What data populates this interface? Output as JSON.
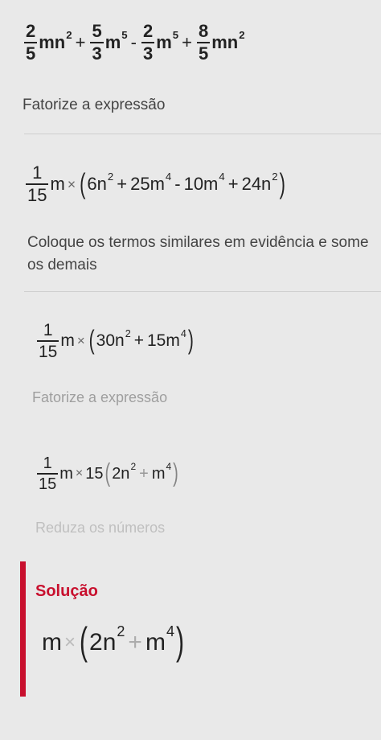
{
  "expression": {
    "f1": {
      "num": "2",
      "den": "5"
    },
    "t1": "mn",
    "e1": "2",
    "op1": "+",
    "f2": {
      "num": "5",
      "den": "3"
    },
    "t2": "m",
    "e2": "5",
    "op2": "-",
    "f3": {
      "num": "2",
      "den": "3"
    },
    "t3": "m",
    "e3": "5",
    "op3": "+",
    "f4": {
      "num": "8",
      "den": "5"
    },
    "t4": "mn",
    "e4": "2"
  },
  "step1": {
    "label": "Fatorize a expressão",
    "f": {
      "num": "1",
      "den": "15"
    },
    "var": "m",
    "times": "×",
    "a": "6n",
    "ae": "2",
    "op1": "+",
    "b": "25m",
    "be": "4",
    "op2": "-",
    "c": "10m",
    "ce": "4",
    "op3": "+",
    "d": "24n",
    "de": "2"
  },
  "step2": {
    "label": "Coloque os termos similares em evidência e some os demais",
    "f": {
      "num": "1",
      "den": "15"
    },
    "var": "m",
    "times": "×",
    "a": "30n",
    "ae": "2",
    "op": "+",
    "b": "15m",
    "be": "4"
  },
  "step3": {
    "label": "Fatorize a expressão",
    "f": {
      "num": "1",
      "den": "15"
    },
    "var": "m",
    "times": "×",
    "k": "15",
    "a": "2n",
    "ae": "2",
    "op": "+",
    "b": "m",
    "be": "4"
  },
  "step4": {
    "label": "Reduza os números"
  },
  "solution": {
    "title": "Solução",
    "var": "m",
    "times": "×",
    "a": "2n",
    "ae": "2",
    "op": "+",
    "b": "m",
    "be": "4"
  },
  "colors": {
    "accent": "#c8102e",
    "text": "#222222",
    "background": "#e9e9e9"
  }
}
